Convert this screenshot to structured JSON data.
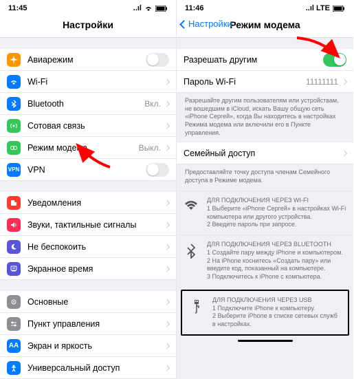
{
  "left": {
    "status": {
      "time": "11:45",
      "net": "..ıl",
      "wifi": true,
      "battery": true
    },
    "title": "Настройки",
    "section1": [
      {
        "key": "airplane",
        "label": "Авиарежим",
        "bg": "#ff9500",
        "toggle": "off"
      },
      {
        "key": "wifi",
        "label": "Wi-Fi",
        "bg": "#007aff",
        "value": " "
      },
      {
        "key": "bluetooth",
        "label": "Bluetooth",
        "bg": "#007aff",
        "value": "Вкл."
      },
      {
        "key": "cellular",
        "label": "Сотовая связь",
        "bg": "#34c759"
      },
      {
        "key": "hotspot",
        "label": "Режим модема",
        "bg": "#34c759",
        "value": "Выкл."
      },
      {
        "key": "vpn",
        "label": "VPN",
        "bg": "#007aff",
        "toggle": "off"
      }
    ],
    "section2": [
      {
        "key": "notifications",
        "label": "Уведомления",
        "bg": "#ff3b30"
      },
      {
        "key": "sounds",
        "label": "Звуки, тактильные сигналы",
        "bg": "#ff3b30"
      },
      {
        "key": "dnd",
        "label": "Не беспокоить",
        "bg": "#5856d6"
      },
      {
        "key": "screentime",
        "label": "Экранное время",
        "bg": "#5856d6"
      }
    ],
    "section3": [
      {
        "key": "general",
        "label": "Основные",
        "bg": "#8e8e93"
      },
      {
        "key": "control",
        "label": "Пункт управления",
        "bg": "#8e8e93"
      },
      {
        "key": "display",
        "label": "Экран и яркость",
        "bg": "#007aff"
      },
      {
        "key": "accessibility",
        "label": "Универсальный доступ",
        "bg": "#007aff"
      }
    ]
  },
  "right": {
    "status": {
      "time": "11:46",
      "net": "..ıl LTE",
      "battery": true
    },
    "back_label": "Настройки",
    "title": "Режим модема",
    "allow_row": {
      "label": "Разрешать другим",
      "toggle": "on"
    },
    "password_row": {
      "label": "Пароль Wi-Fi",
      "value": "11111111"
    },
    "note": "Разрешайте другим пользователям или устройствам, не вошедшим в iCloud, искать Вашу общую сеть «iPhone Сергей», когда Вы находитесь в настройках Режима модема или включили его в Пункте управления.",
    "family_row": {
      "label": "Семейный доступ"
    },
    "family_note": "Предоставляйте точку доступа членам Семейного доступа в Режиме модема.",
    "wifi_block": {
      "title": "ДЛЯ ПОДКЛЮЧЕНИЯ ЧЕРЕЗ WI-FI",
      "s1": "1 Выберите «iPhone Сергей» в настройках Wi-Fi компьютера или другого устройства.",
      "s2": "2 Введите пароль при запросе."
    },
    "bt_block": {
      "title": "ДЛЯ ПОДКЛЮЧЕНИЯ ЧЕРЕЗ BLUETOOTH",
      "s1": "1 Создайте пару между iPhone и компьютером.",
      "s2": "2 На iPhone коснитесь «Создать пару» или введите код, показанный на компьютере.",
      "s3": "3 Подключитесь к iPhone с компьютера."
    },
    "usb_block": {
      "title": "ДЛЯ ПОДКЛЮЧЕНИЯ ЧЕРЕЗ USB",
      "s1": "1 Подключите iPhone к компьютеру.",
      "s2": "2 Выберите iPhone в списке сетевых служб в настройках."
    }
  }
}
